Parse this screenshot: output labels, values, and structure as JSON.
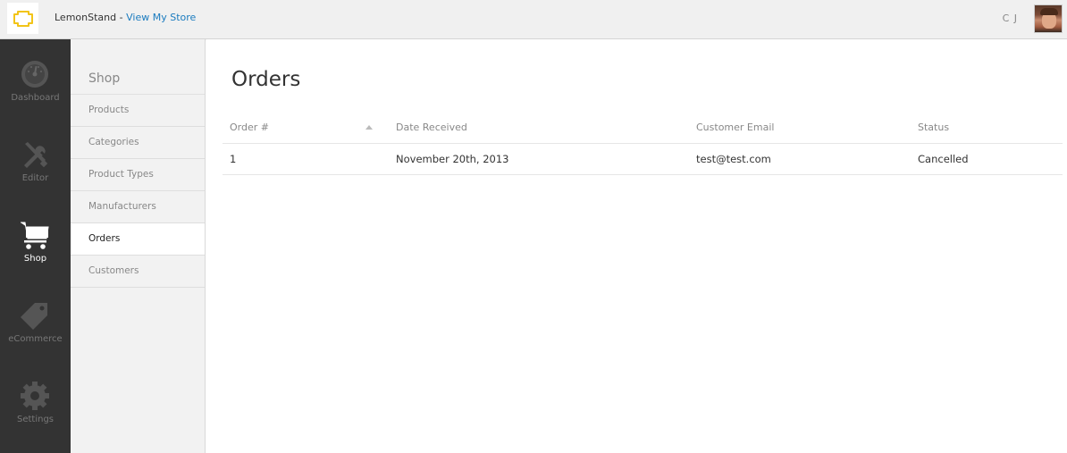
{
  "header": {
    "brand_name": "LemonStand",
    "separator": "-",
    "store_link": "View My Store",
    "user_initials": "C J",
    "accent_color": "#1a7bbf",
    "logo_color": "#f2c418"
  },
  "main_nav": {
    "items": [
      {
        "label": "Dashboard",
        "icon": "gauge-icon",
        "active": false
      },
      {
        "label": "Editor",
        "icon": "tools-icon",
        "active": false
      },
      {
        "label": "Shop",
        "icon": "cart-icon",
        "active": true
      },
      {
        "label": "eCommerce",
        "icon": "tag-icon",
        "active": false
      },
      {
        "label": "Settings",
        "icon": "gear-icon",
        "active": false
      }
    ]
  },
  "sub_nav": {
    "title": "Shop",
    "items": [
      {
        "label": "Products",
        "active": false
      },
      {
        "label": "Categories",
        "active": false
      },
      {
        "label": "Product Types",
        "active": false
      },
      {
        "label": "Manufacturers",
        "active": false
      },
      {
        "label": "Orders",
        "active": true
      },
      {
        "label": "Customers",
        "active": false
      }
    ]
  },
  "page": {
    "title": "Orders",
    "columns": [
      "Order #",
      "Date Received",
      "Customer Email",
      "Status"
    ],
    "rows": [
      {
        "order": "1",
        "date": "November 20th, 2013",
        "email": "test@test.com",
        "status": "Cancelled"
      }
    ]
  }
}
